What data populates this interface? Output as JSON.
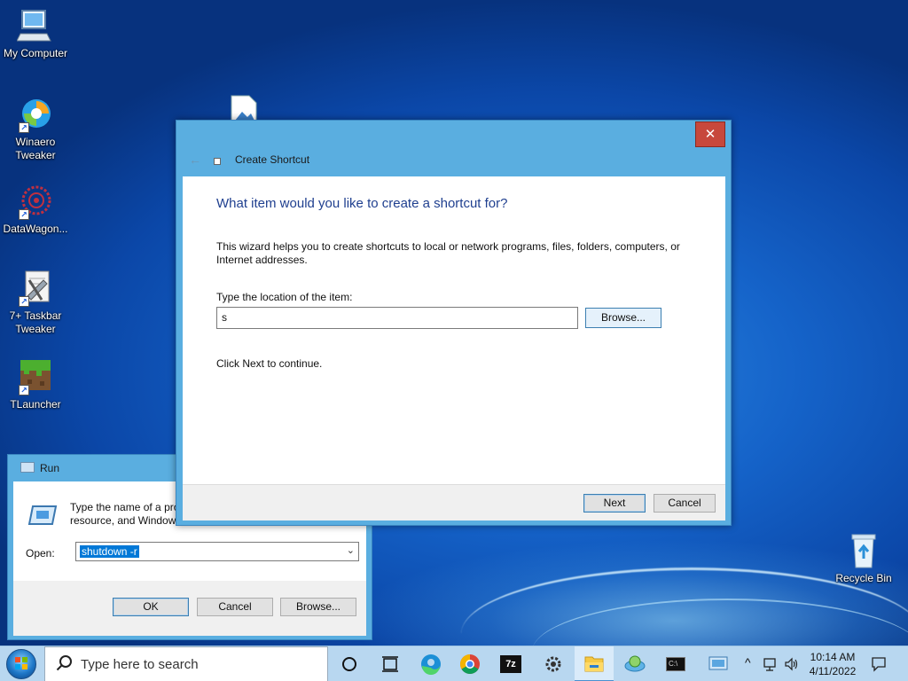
{
  "desktop": {
    "icons": [
      {
        "label": "My Computer",
        "icon": "computer-icon"
      },
      {
        "label": "Winaero Tweaker",
        "icon": "winaero-icon"
      },
      {
        "label": "DataWagon...",
        "icon": "datawagon-icon"
      },
      {
        "label": "7+ Taskbar Tweaker",
        "icon": "taskbar-tweaker-icon"
      },
      {
        "label": "TLauncher",
        "icon": "tlauncher-icon"
      },
      {
        "label": "Recycle Bin",
        "icon": "recycle-bin-icon"
      }
    ]
  },
  "wizard": {
    "title": "Create Shortcut",
    "close_label": "✕",
    "heading": "What item would you like to create a shortcut for?",
    "description": "This wizard helps you to create shortcuts to local or network programs, files, folders, computers, or Internet addresses.",
    "location_label": "Type the location of the item:",
    "location_value": "s",
    "browse_label": "Browse...",
    "continue_text": "Click Next to continue.",
    "next_label": "Next",
    "cancel_label": "Cancel"
  },
  "run": {
    "title": "Run",
    "description_line1": "Type the name of a pro",
    "description_line2": "resource, and Window",
    "open_label": "Open:",
    "open_value": "shutdown -r",
    "ok_label": "OK",
    "cancel_label": "Cancel",
    "browse_label": "Browse..."
  },
  "taskbar": {
    "search_placeholder": "Type here to search",
    "time": "10:14 AM",
    "date": "4/11/2022",
    "apps": [
      "cortana-icon",
      "task-view-icon",
      "edge-icon",
      "chrome-icon",
      "7zip-icon",
      "settings-icon",
      "file-explorer-icon",
      "network-globe-icon",
      "cmd-icon",
      "remote-desktop-icon"
    ],
    "sevenzip_label": "7z",
    "cmd_label": "C:\\"
  },
  "colors": {
    "accent": "#0078d7",
    "titlebar": "#5aaee0",
    "close": "#c7483c",
    "heading": "#1f3f8f",
    "taskbar": "#b8d7f0"
  }
}
